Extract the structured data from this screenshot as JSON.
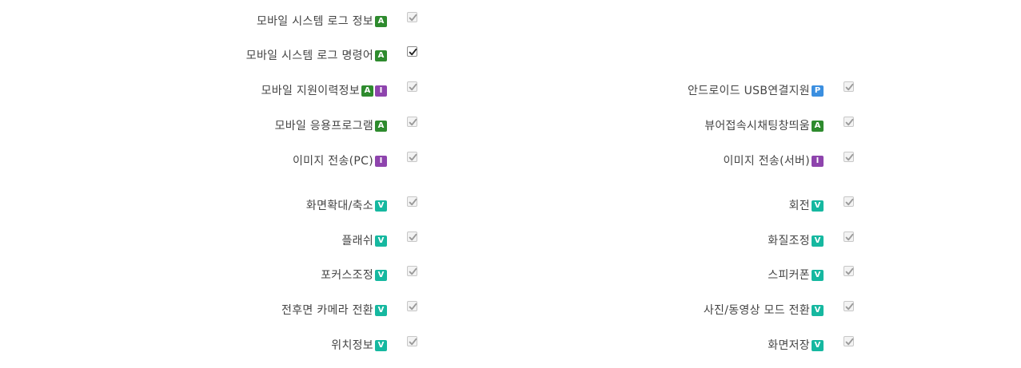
{
  "colors": {
    "badge_A": "#2e8b2e",
    "badge_I": "#8e44ad",
    "badge_P": "#3b8fe0",
    "badge_V": "#16b8a0"
  },
  "left": [
    {
      "label": "모바일 시스템 로그 정보",
      "badges": [
        "A"
      ],
      "checked": true,
      "enabled": false
    },
    {
      "label": "모바일 시스템 로그 명령어",
      "badges": [
        "A"
      ],
      "checked": true,
      "enabled": true
    },
    {
      "label": "모바일 지원이력정보",
      "badges": [
        "A",
        "I"
      ],
      "checked": true,
      "enabled": false
    },
    {
      "label": "모바일 응용프로그램",
      "badges": [
        "A"
      ],
      "checked": true,
      "enabled": false
    },
    {
      "label": "이미지 전송(PC)",
      "badges": [
        "I"
      ],
      "checked": true,
      "enabled": false
    },
    {
      "label": "화면확대/축소",
      "badges": [
        "V"
      ],
      "checked": true,
      "enabled": false
    },
    {
      "label": "플래쉬",
      "badges": [
        "V"
      ],
      "checked": true,
      "enabled": false
    },
    {
      "label": "포커스조정",
      "badges": [
        "V"
      ],
      "checked": true,
      "enabled": false
    },
    {
      "label": "전후면 카메라 전환",
      "badges": [
        "V"
      ],
      "checked": true,
      "enabled": false
    },
    {
      "label": "위치정보",
      "badges": [
        "V"
      ],
      "checked": true,
      "enabled": false
    }
  ],
  "right": [
    {
      "label": "안드로이드 USB연결지원",
      "badges": [
        "P"
      ],
      "checked": true,
      "enabled": false
    },
    {
      "label": "뷰어접속시채팅창띄움",
      "badges": [
        "A"
      ],
      "checked": true,
      "enabled": false
    },
    {
      "label": "이미지 전송(서버)",
      "badges": [
        "I"
      ],
      "checked": true,
      "enabled": false
    },
    {
      "label": "회전",
      "badges": [
        "V"
      ],
      "checked": true,
      "enabled": false
    },
    {
      "label": "화질조정",
      "badges": [
        "V"
      ],
      "checked": true,
      "enabled": false
    },
    {
      "label": "스피커폰",
      "badges": [
        "V"
      ],
      "checked": true,
      "enabled": false
    },
    {
      "label": "사진/동영상 모드 전환",
      "badges": [
        "V"
      ],
      "checked": true,
      "enabled": false
    },
    {
      "label": "화면저장",
      "badges": [
        "V"
      ],
      "checked": true,
      "enabled": false
    }
  ]
}
